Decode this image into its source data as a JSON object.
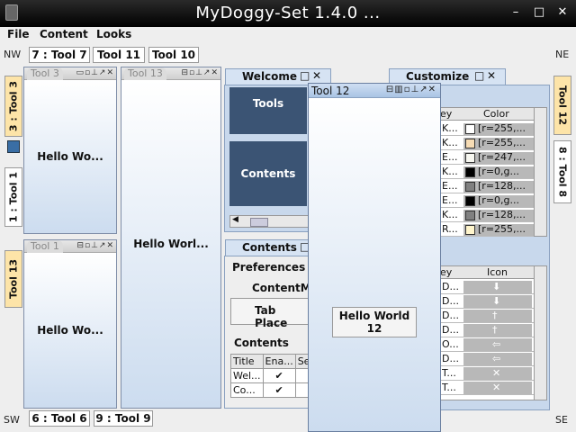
{
  "window": {
    "title": "MyDoggy-Set 1.4.0 ...",
    "controls": [
      "–",
      "□",
      "✕"
    ]
  },
  "menu": [
    "File",
    "Content",
    "Looks"
  ],
  "corners": {
    "nw": "NW",
    "ne": "NE",
    "sw": "SW",
    "se": "SE"
  },
  "top_bar": [
    "7 : Tool 7",
    "Tool 11",
    "Tool 10"
  ],
  "bottom_bar": [
    "6 : Tool 6",
    "9 : Tool 9"
  ],
  "left_bar": [
    "3 : Tool 3",
    "1 : Tool 1",
    "Tool 13"
  ],
  "right_bar": [
    "Tool 12",
    "8 : Tool 8"
  ],
  "tool3": {
    "title": "Tool 3",
    "content": "Hello Wo..."
  },
  "tool1": {
    "title": "Tool 1",
    "content": "Hello Wo..."
  },
  "tool13": {
    "title": "Tool 13",
    "content": "Hello Worl..."
  },
  "tool12": {
    "title": "Tool 12",
    "content": "Hello World 12"
  },
  "welcome": {
    "tab": "Welcome",
    "tools": "Tools",
    "contents": "Contents"
  },
  "contents_tab": {
    "tab": "Contents",
    "preferences": "Preferences",
    "content_m": "ContentM",
    "tab_place": "Tab Place",
    "group": "Contents",
    "headers": [
      "Title",
      "Ena...",
      "Se"
    ],
    "rows": [
      [
        "Wel...",
        "✔"
      ],
      [
        "Co...",
        "✔"
      ]
    ]
  },
  "customize": {
    "tab": "Customize",
    "color_header": [
      "ey",
      "Color"
    ],
    "colors": [
      {
        "key": "K...",
        "swatch": "#ffffff",
        "value": "[r=255,..."
      },
      {
        "key": "K...",
        "swatch": "#f7dcb4",
        "value": "[r=255,..."
      },
      {
        "key": "E...",
        "swatch": "#f7f7f0",
        "value": "[r=247,..."
      },
      {
        "key": "K...",
        "swatch": "#000000",
        "value": "[r=0,g..."
      },
      {
        "key": "E...",
        "swatch": "#808080",
        "value": "[r=128,..."
      },
      {
        "key": "E...",
        "swatch": "#000000",
        "value": "[r=0,g..."
      },
      {
        "key": "K...",
        "swatch": "#808080",
        "value": "[r=128,..."
      },
      {
        "key": "R...",
        "swatch": "#fff5cc",
        "value": "[r=255,..."
      }
    ],
    "icon_header": [
      "ey",
      "Icon"
    ],
    "icons": [
      {
        "key": "D...",
        "icon": "⬇"
      },
      {
        "key": "D...",
        "icon": "⬇"
      },
      {
        "key": "D...",
        "icon": "†"
      },
      {
        "key": "D...",
        "icon": "†"
      },
      {
        "key": "O...",
        "icon": "⇦"
      },
      {
        "key": "D...",
        "icon": "⇦"
      },
      {
        "key": "T...",
        "icon": "✕"
      },
      {
        "key": "T...",
        "icon": "✕"
      }
    ]
  },
  "colors": {
    "accent": "#fde4a8",
    "panel_dark": "#3b5474",
    "tab_blue": "#d6e3f3"
  }
}
